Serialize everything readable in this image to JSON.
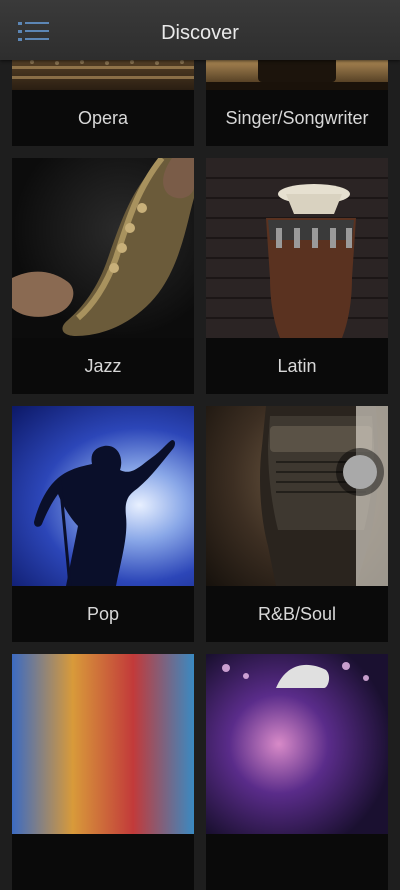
{
  "header": {
    "title": "Discover"
  },
  "icons": {
    "menu": "hamburger-menu-icon"
  },
  "genres": [
    {
      "label": "Opera"
    },
    {
      "label": "Singer/Songwriter"
    },
    {
      "label": "Jazz"
    },
    {
      "label": "Latin"
    },
    {
      "label": "Pop"
    },
    {
      "label": "R&B/Soul"
    }
  ]
}
